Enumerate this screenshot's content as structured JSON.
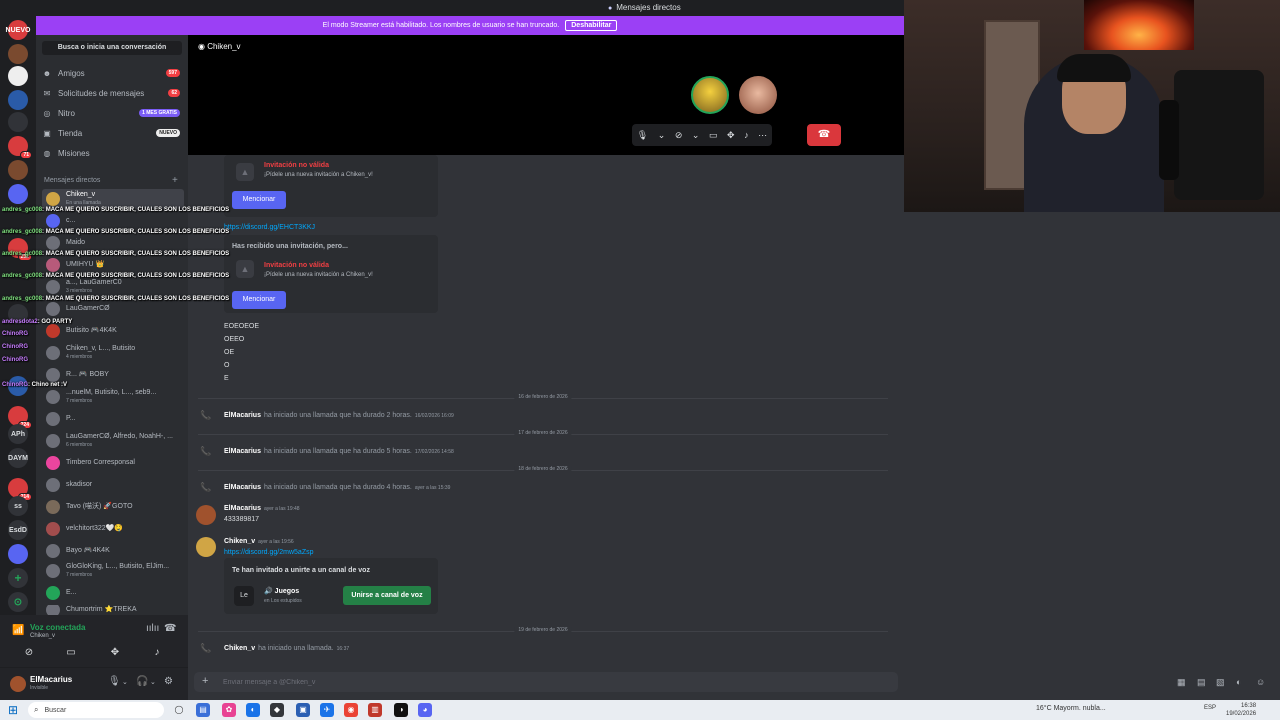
{
  "window": {
    "title": "Mensajes directos"
  },
  "banner": {
    "text": "El modo Streamer está habilitado. Los nombres de usuario se han truncado.",
    "disable_label": "Deshabilitar"
  },
  "rail": {
    "new_label": "NUEVO",
    "new_badge": "NEW",
    "text_items": [
      "APh",
      "DAYM",
      "ss",
      "EsdD"
    ],
    "badges": [
      "71",
      "232",
      "224",
      "214"
    ]
  },
  "sidebar": {
    "search_label": "Busca o inicia una conversación",
    "nav": [
      {
        "label": "Amigos",
        "badge": "597",
        "icon": "friends-icon"
      },
      {
        "label": "Solicitudes de mensajes",
        "badge": "62",
        "icon": "mail-icon"
      },
      {
        "label": "Nitro",
        "badge": "1 MES GRATIS",
        "icon": "nitro-icon"
      },
      {
        "label": "Tienda",
        "badge": "NUEVO",
        "icon": "shop-icon"
      },
      {
        "label": "Misiones",
        "badge": "",
        "icon": "quest-icon"
      }
    ],
    "dm_header": "Mensajes directos",
    "dms": [
      {
        "name": "Chiken_v",
        "sub": "En una llamada"
      },
      {
        "name": "c...",
        "sub": ""
      },
      {
        "name": "Maido",
        "sub": ""
      },
      {
        "name": "UMIHYU 👑",
        "sub": ""
      },
      {
        "name": "a..., LauGamerC0",
        "sub": "3 miembros"
      },
      {
        "name": "LauGamerCØ",
        "sub": ""
      },
      {
        "name": "Butisito  🎮4K4K",
        "sub": ""
      },
      {
        "name": "Chiken_v, L..., Butisito",
        "sub": "4 miembros"
      },
      {
        "name": "R...  🎮 BOBY",
        "sub": ""
      },
      {
        "name": "...nuelM, Butisito, L..., seb9...",
        "sub": "7 miembros"
      },
      {
        "name": "P...",
        "sub": ""
      },
      {
        "name": "LauGamerCØ, Alfredo, NoahH-, ...",
        "sub": "6 miembros"
      },
      {
        "name": "Timbero Corresponsal",
        "sub": ""
      },
      {
        "name": "skadisor",
        "sub": ""
      },
      {
        "name": "Tavo (喵沃)  🚀GOTO",
        "sub": ""
      },
      {
        "name": "velchitort322🤍🤤",
        "sub": ""
      },
      {
        "name": "Bayo  🎮4K4K",
        "sub": ""
      },
      {
        "name": "GloGloKing, L..., Butisito, ElJim...",
        "sub": "7 miembros"
      },
      {
        "name": "E...",
        "sub": ""
      },
      {
        "name": "Chumortrim ⭐TREKA",
        "sub": ""
      }
    ]
  },
  "voice_panel": {
    "status": "Voz conectada",
    "channel": "Chiken_v"
  },
  "user_panel": {
    "name": "ElMacarius",
    "status": "Invisible"
  },
  "channel": {
    "name": "Chiken_v",
    "invites": [
      {
        "head": "",
        "title": "Invitación no válida",
        "sub": "¡Pídele una nueva invitación a Chiken_v!",
        "button": "Mencionar"
      },
      {
        "head": "Has recibido una invitación, pero...",
        "title": "Invitación no válida",
        "sub": "¡Pídele una nueva invitación a Chiken_v!",
        "button": "Mencionar"
      }
    ],
    "link1": "https://discord.gg/EHCT3KKJ",
    "lines": [
      "EOEOEOE",
      "OEEO",
      "OE",
      "O",
      "E"
    ],
    "dividers": [
      "16 de febrero de 2026",
      "17 de febrero de 2026",
      "18 de febrero de 2026",
      "19 de febrero de 2026"
    ],
    "calls": [
      {
        "author": "ElMacarius",
        "text": "ha iniciado una llamada que ha durado 2 horas.",
        "ts": "16/02/2026 16:09"
      },
      {
        "author": "ElMacarius",
        "text": "ha iniciado una llamada que ha durado 5 horas.",
        "ts": "17/02/2026 14:58"
      },
      {
        "author": "ElMacarius",
        "text": "ha iniciado una llamada que ha durado 4 horas.",
        "ts": "ayer a las 15:39"
      },
      {
        "author": "Chiken_v",
        "text": "ha iniciado una llamada.",
        "ts": "16:37"
      }
    ],
    "msg1": {
      "author": "ElMacarius",
      "ts": "ayer a las 19:48",
      "text": "433389817"
    },
    "msg2": {
      "author": "Chiken_v",
      "ts": "ayer a las 19:56",
      "link": "https://discord.gg/2mw5aZsp"
    },
    "voice_invite": {
      "title": "Te han invitado a unirte a un canal de voz",
      "icon_text": "Le",
      "name": "Juegos",
      "location": "en Los estupidos",
      "join": "Unirse a canal de voz"
    },
    "composer_placeholder": "Enviar mensaje a @Chiken_v"
  },
  "stream_chat": [
    {
      "user": "andres_gc008",
      "text": ": MACA ME QUIERO SUSCRIBIR, CUALES SON LOS BENEFICIOS"
    },
    {
      "user": "andres_gc008",
      "text": ": MACA ME QUIERO SUSCRIBIR, CUALES SON LOS BENEFICIOS"
    },
    {
      "user": "andres_gc008",
      "text": ": MACA ME QUIERO SUSCRIBIR, CUALES SON LOS BENEFICIOS"
    },
    {
      "user": "andres_gc008",
      "text": ": MACA ME QUIERO SUSCRIBIR, CUALES SON LOS BENEFICIOS"
    },
    {
      "user": "andres_gc008",
      "text": ": MACA ME QUIERO SUSCRIBIR, CUALES SON LOS BENEFICIOS"
    },
    {
      "user": "andresdota2",
      "text": ": GO PARTY"
    },
    {
      "user": "ChinoRG",
      "text": ""
    },
    {
      "user": "ChinoRG",
      "text": ""
    },
    {
      "user": "ChinoRG",
      "text": ""
    },
    {
      "user": "ChinoRG",
      "text": ": Chino net :V"
    }
  ],
  "taskbar": {
    "search": "Buscar",
    "weather": "16°C  Mayorm. nubla...",
    "lang": "ESP",
    "time": "16:38",
    "date": "19/02/2026"
  },
  "colors": {
    "accent": "#5865f2",
    "streamer_banner": "#9b40f5",
    "online": "#23a559",
    "hangup": "#da373c"
  }
}
